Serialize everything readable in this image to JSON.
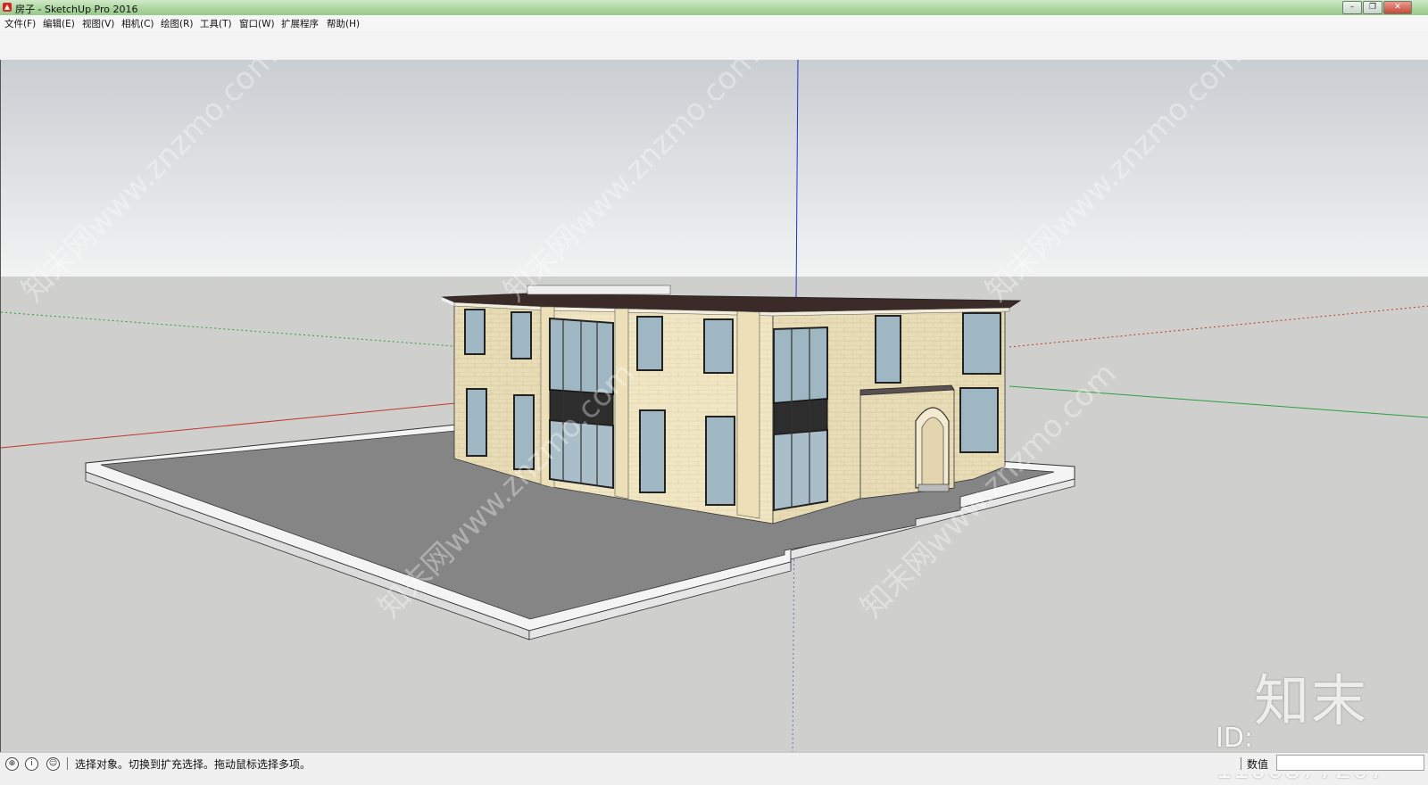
{
  "window": {
    "title": "房子 - SketchUp Pro 2016",
    "controls": {
      "minimize": "–",
      "restore": "❐",
      "close": "✕"
    }
  },
  "menu": {
    "items": [
      {
        "label": "文件(F)"
      },
      {
        "label": "编辑(E)"
      },
      {
        "label": "视图(V)"
      },
      {
        "label": "相机(C)"
      },
      {
        "label": "绘图(R)"
      },
      {
        "label": "工具(T)"
      },
      {
        "label": "窗口(W)"
      },
      {
        "label": "扩展程序"
      },
      {
        "label": "帮助(H)"
      }
    ]
  },
  "viewport": {
    "model": "house-3d-model",
    "sky_color": "#e9ebec",
    "ground_color": "#cfcfcd",
    "axis_colors": {
      "red": "#c0392b",
      "green": "#2e9e44",
      "blue": "#2233cc"
    },
    "watermarks": [
      "知末网www.znzmo.com"
    ]
  },
  "brand": {
    "logo": "知末",
    "id": "ID: 1100877207"
  },
  "status": {
    "icons": [
      "geo-location-icon",
      "info-icon",
      "user-icon"
    ],
    "message": "选择对象。切换到扩充选择。拖动鼠标选择多项。",
    "measure_label": "数值",
    "measure_value": ""
  }
}
